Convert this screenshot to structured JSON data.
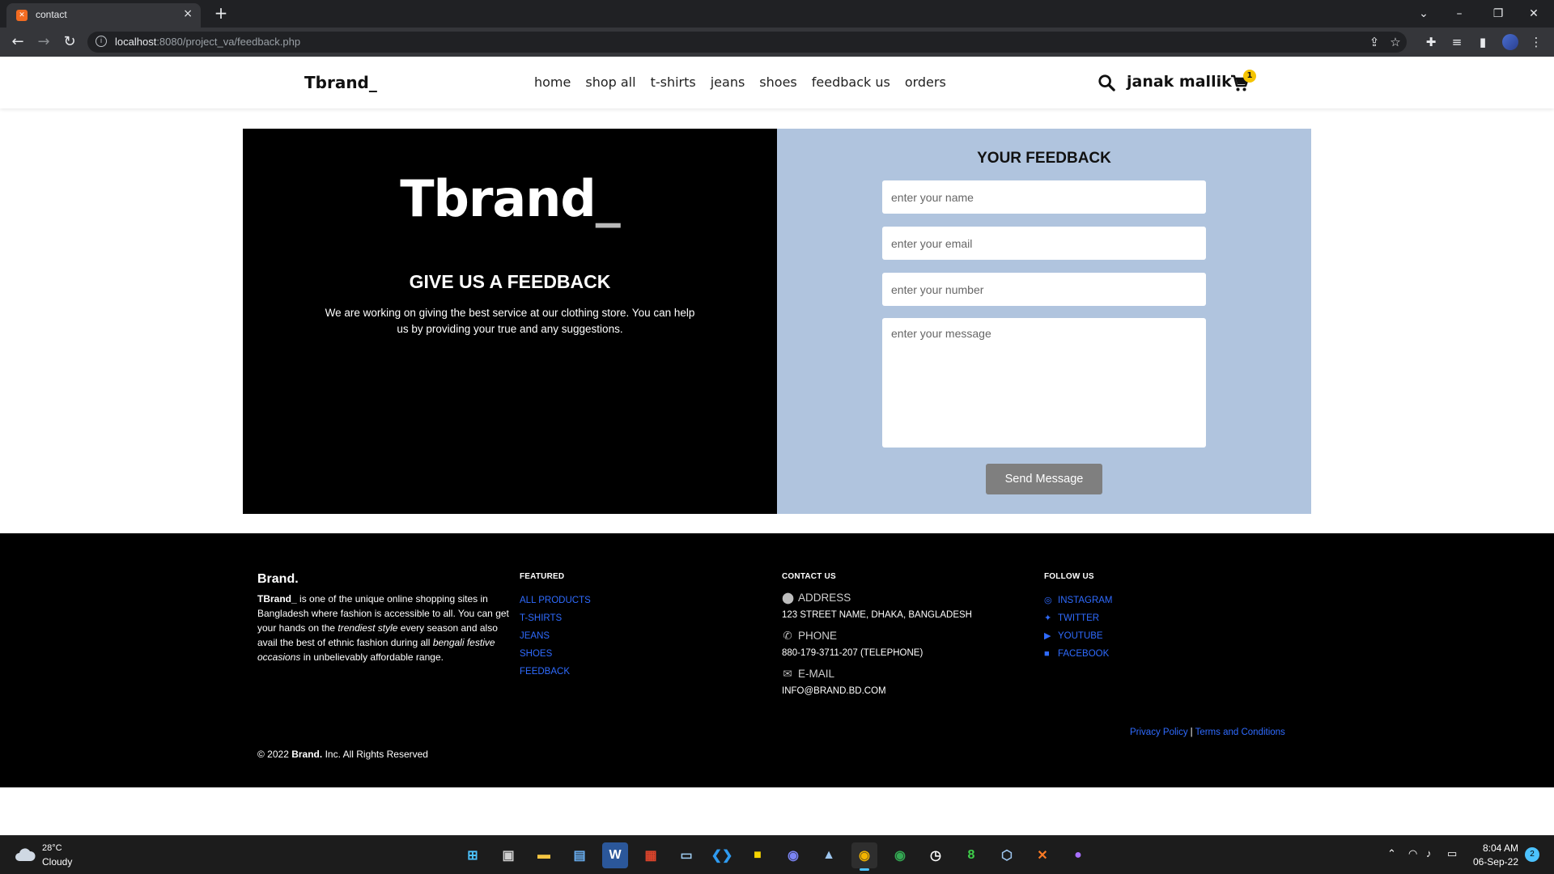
{
  "browser": {
    "tab_title": "contact",
    "tab_close": "×",
    "new_tab": "+",
    "url_host": "localhost",
    "url_path": ":8080/project_va/feedback.php"
  },
  "site": {
    "logo": "Tbrand_",
    "nav": [
      "home",
      "shop all",
      "t-shirts",
      "jeans",
      "shoes",
      "feedback us",
      "orders"
    ],
    "username": "janak mallik",
    "cart_count": "1"
  },
  "feedback": {
    "big_logo_text": "Tbrand",
    "big_logo_underscore": "_",
    "heading": "GIVE US A FEEDBACK",
    "text": "We are working on giving the best service at our clothing store. You can help us by providing your true and any suggestions.",
    "form_title": "YOUR FEEDBACK",
    "name_placeholder": "enter your name",
    "email_placeholder": "enter your email",
    "number_placeholder": "enter your number",
    "message_placeholder": "enter your message",
    "send_label": "Send Message"
  },
  "footer": {
    "brand": "Brand.",
    "about_brand": "TBrand_",
    "about_1": " is one of the unique online shopping sites in Bangladesh where fashion is accessible to all. You can get your hands on the ",
    "about_em1": "trendiest style",
    "about_2": " every season and also avail the best of ethnic fashion during all ",
    "about_em2": "bengali festive occasions",
    "about_3": " in unbelievably affordable range.",
    "featured_title": "FEATURED",
    "featured_links": [
      "ALL PRODUCTS",
      "T-SHIRTS",
      "JEANS",
      "SHOES",
      "FEEDBACK"
    ],
    "contact_title": "CONTACT US",
    "address_label": "ADDRESS",
    "address_value": "123 STREET NAME, DHAKA, BANGLADESH",
    "phone_label": "PHONE",
    "phone_value": "880-179-3711-207 (TELEPHONE)",
    "email_label": "E-MAIL",
    "email_value": "INFO@BRAND.BD.COM",
    "follow_title": "FOLLOW US",
    "social_links": [
      "INSTAGRAM",
      "TWITTER",
      "YOUTUBE",
      "FACEBOOK"
    ],
    "privacy": "Privacy Policy",
    "separator": "|",
    "terms": "Terms and Conditions",
    "copy_prefix": "© 2022 ",
    "copy_brand": "Brand.",
    "copy_suffix": " Inc. All Rights Reserved"
  },
  "taskbar": {
    "temp": "28°C",
    "condition": "Cloudy",
    "time": "8:04 AM",
    "date": "06-Sep-22",
    "notifications": "2"
  },
  "colors": {
    "form_panel": "#b0c4de",
    "link": "#2f6bff",
    "cart_badge": "#f5c400"
  }
}
